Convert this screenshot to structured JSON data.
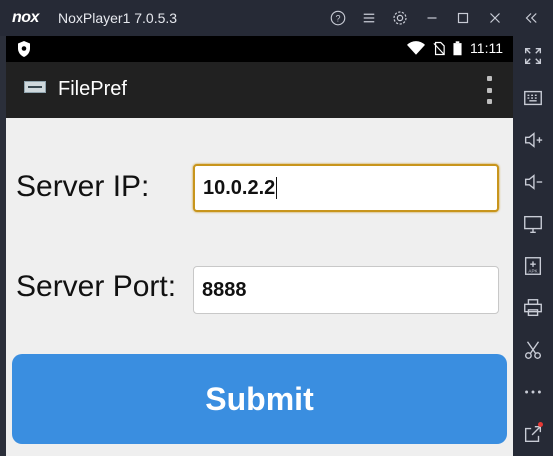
{
  "window": {
    "logo_text": "nox",
    "title": "NoxPlayer1  7.0.5.3",
    "buttons": [
      "help-icon",
      "menu-icon",
      "settings-icon",
      "minimize-icon",
      "maximize-icon",
      "close-icon",
      "collapse-sidebar-icon"
    ]
  },
  "statusbar": {
    "time": "11:11",
    "icons": [
      "shield-icon",
      "wifi-icon",
      "no-sim-icon",
      "battery-icon"
    ]
  },
  "appbar": {
    "title": "FilePref"
  },
  "form": {
    "ip_label": "Server IP:",
    "ip_value": "10.0.2.2",
    "port_label": "Server Port:",
    "port_value": "8888",
    "submit_label": "Submit"
  },
  "sidebar": {
    "icons": [
      "fullscreen-icon",
      "keyboard-icon",
      "volume-up-icon",
      "volume-down-icon",
      "screen-icon",
      "add-apk-icon",
      "printer-icon",
      "scissors-icon",
      "more-icon",
      "external-link-icon"
    ]
  },
  "colors": {
    "accent_button": "#3a8ee0",
    "focus_border": "#c8951c",
    "appbar": "#212121",
    "nox_chrome": "#262a36"
  }
}
